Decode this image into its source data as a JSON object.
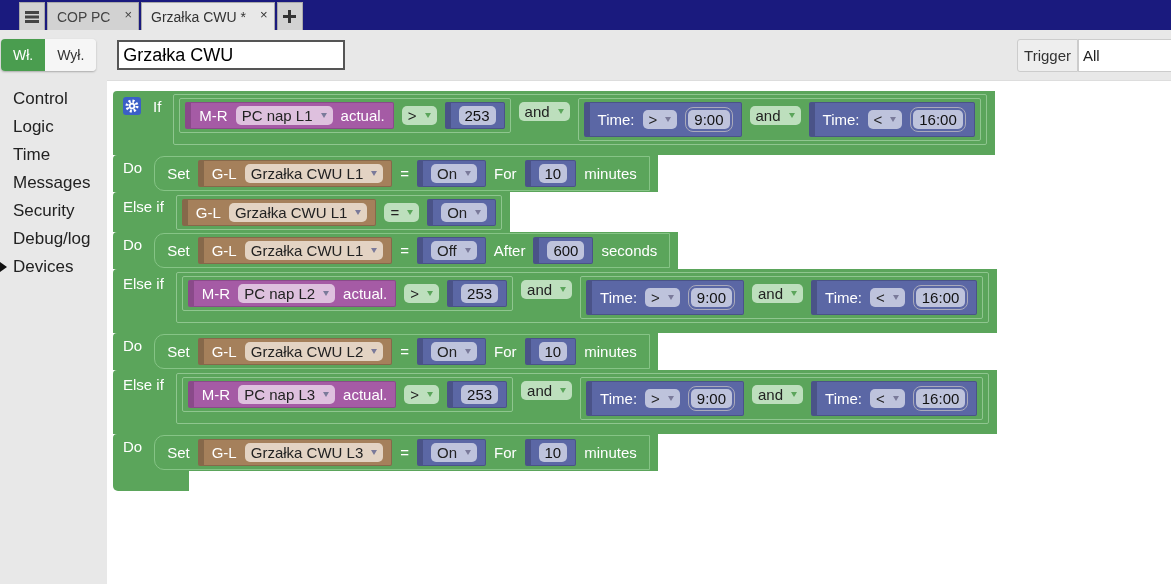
{
  "tabs": [
    {
      "label": "COP PC",
      "close": "×",
      "selected": false
    },
    {
      "label": "Grzałka CWU *",
      "close": "×",
      "selected": true
    }
  ],
  "toolbar": {
    "toggle": [
      {
        "label": "Wł.",
        "selected": true
      },
      {
        "label": "Wył.",
        "selected": false
      }
    ],
    "name_field": {
      "value": "Grzałka CWU"
    },
    "trigger": {
      "label": "Trigger",
      "value": "All"
    }
  },
  "sidebar": {
    "items": [
      {
        "label": "Control",
        "selected": false
      },
      {
        "label": "Logic",
        "selected": false
      },
      {
        "label": "Time",
        "selected": false
      },
      {
        "label": "Messages",
        "selected": false
      },
      {
        "label": "Security",
        "selected": false
      },
      {
        "label": "Debug/log",
        "selected": false
      },
      {
        "label": "Devices",
        "selected": true
      }
    ]
  },
  "script": {
    "rows": [
      {
        "kind": "if",
        "label": "If",
        "condition": {
          "kind": "and",
          "op": "and",
          "left": {
            "kind": "compare",
            "left": {
              "kind": "mr",
              "prefix": "M-R",
              "device": "PC nap L1",
              "suffix": "actual."
            },
            "op": ">",
            "right": {
              "kind": "number",
              "value": "253"
            }
          },
          "right": {
            "kind": "and",
            "op": "and",
            "left": {
              "kind": "time",
              "label": "Time:",
              "op": ">",
              "value": "9:00"
            },
            "right": {
              "kind": "time",
              "label": "Time:",
              "op": "<",
              "value": "16:00"
            }
          }
        }
      },
      {
        "kind": "do",
        "label": "Do",
        "action": {
          "kind": "set",
          "label": "Set",
          "target": {
            "kind": "gl",
            "prefix": "G-L",
            "device": "Grzałka CWU L1"
          },
          "op": "=",
          "value": {
            "kind": "state",
            "value": "On"
          },
          "timing": "For",
          "amount": {
            "kind": "number",
            "value": "10"
          },
          "unit": "minutes"
        }
      },
      {
        "kind": "else_if",
        "label": "Else if",
        "condition": {
          "kind": "compare",
          "left": {
            "kind": "gl",
            "prefix": "G-L",
            "device": "Grzałka CWU L1"
          },
          "op": "=",
          "right": {
            "kind": "state",
            "value": "On"
          }
        }
      },
      {
        "kind": "do",
        "label": "Do",
        "action": {
          "kind": "set",
          "label": "Set",
          "target": {
            "kind": "gl",
            "prefix": "G-L",
            "device": "Grzałka CWU L1"
          },
          "op": "=",
          "value": {
            "kind": "state",
            "value": "Off"
          },
          "timing": "After",
          "amount": {
            "kind": "number",
            "value": "600"
          },
          "unit": "seconds"
        }
      },
      {
        "kind": "else_if",
        "label": "Else if",
        "condition": {
          "kind": "and",
          "op": "and",
          "left": {
            "kind": "compare",
            "left": {
              "kind": "mr",
              "prefix": "M-R",
              "device": "PC nap L2",
              "suffix": "actual."
            },
            "op": ">",
            "right": {
              "kind": "number",
              "value": "253"
            }
          },
          "right": {
            "kind": "and",
            "op": "and",
            "left": {
              "kind": "time",
              "label": "Time:",
              "op": ">",
              "value": "9:00"
            },
            "right": {
              "kind": "time",
              "label": "Time:",
              "op": "<",
              "value": "16:00"
            }
          }
        }
      },
      {
        "kind": "do",
        "label": "Do",
        "action": {
          "kind": "set",
          "label": "Set",
          "target": {
            "kind": "gl",
            "prefix": "G-L",
            "device": "Grzałka CWU L2"
          },
          "op": "=",
          "value": {
            "kind": "state",
            "value": "On"
          },
          "timing": "For",
          "amount": {
            "kind": "number",
            "value": "10"
          },
          "unit": "minutes"
        }
      },
      {
        "kind": "else_if",
        "label": "Else if",
        "condition": {
          "kind": "and",
          "op": "and",
          "left": {
            "kind": "compare",
            "left": {
              "kind": "mr",
              "prefix": "M-R",
              "device": "PC nap L3",
              "suffix": "actual."
            },
            "op": ">",
            "right": {
              "kind": "number",
              "value": "253"
            }
          },
          "right": {
            "kind": "and",
            "op": "and",
            "left": {
              "kind": "time",
              "label": "Time:",
              "op": ">",
              "value": "9:00"
            },
            "right": {
              "kind": "time",
              "label": "Time:",
              "op": "<",
              "value": "16:00"
            }
          }
        }
      },
      {
        "kind": "do",
        "label": "Do",
        "action": {
          "kind": "set",
          "label": "Set",
          "target": {
            "kind": "gl",
            "prefix": "G-L",
            "device": "Grzałka CWU L3"
          },
          "op": "=",
          "value": {
            "kind": "state",
            "value": "On"
          },
          "timing": "For",
          "amount": {
            "kind": "number",
            "value": "10"
          },
          "unit": "minutes"
        }
      }
    ]
  }
}
